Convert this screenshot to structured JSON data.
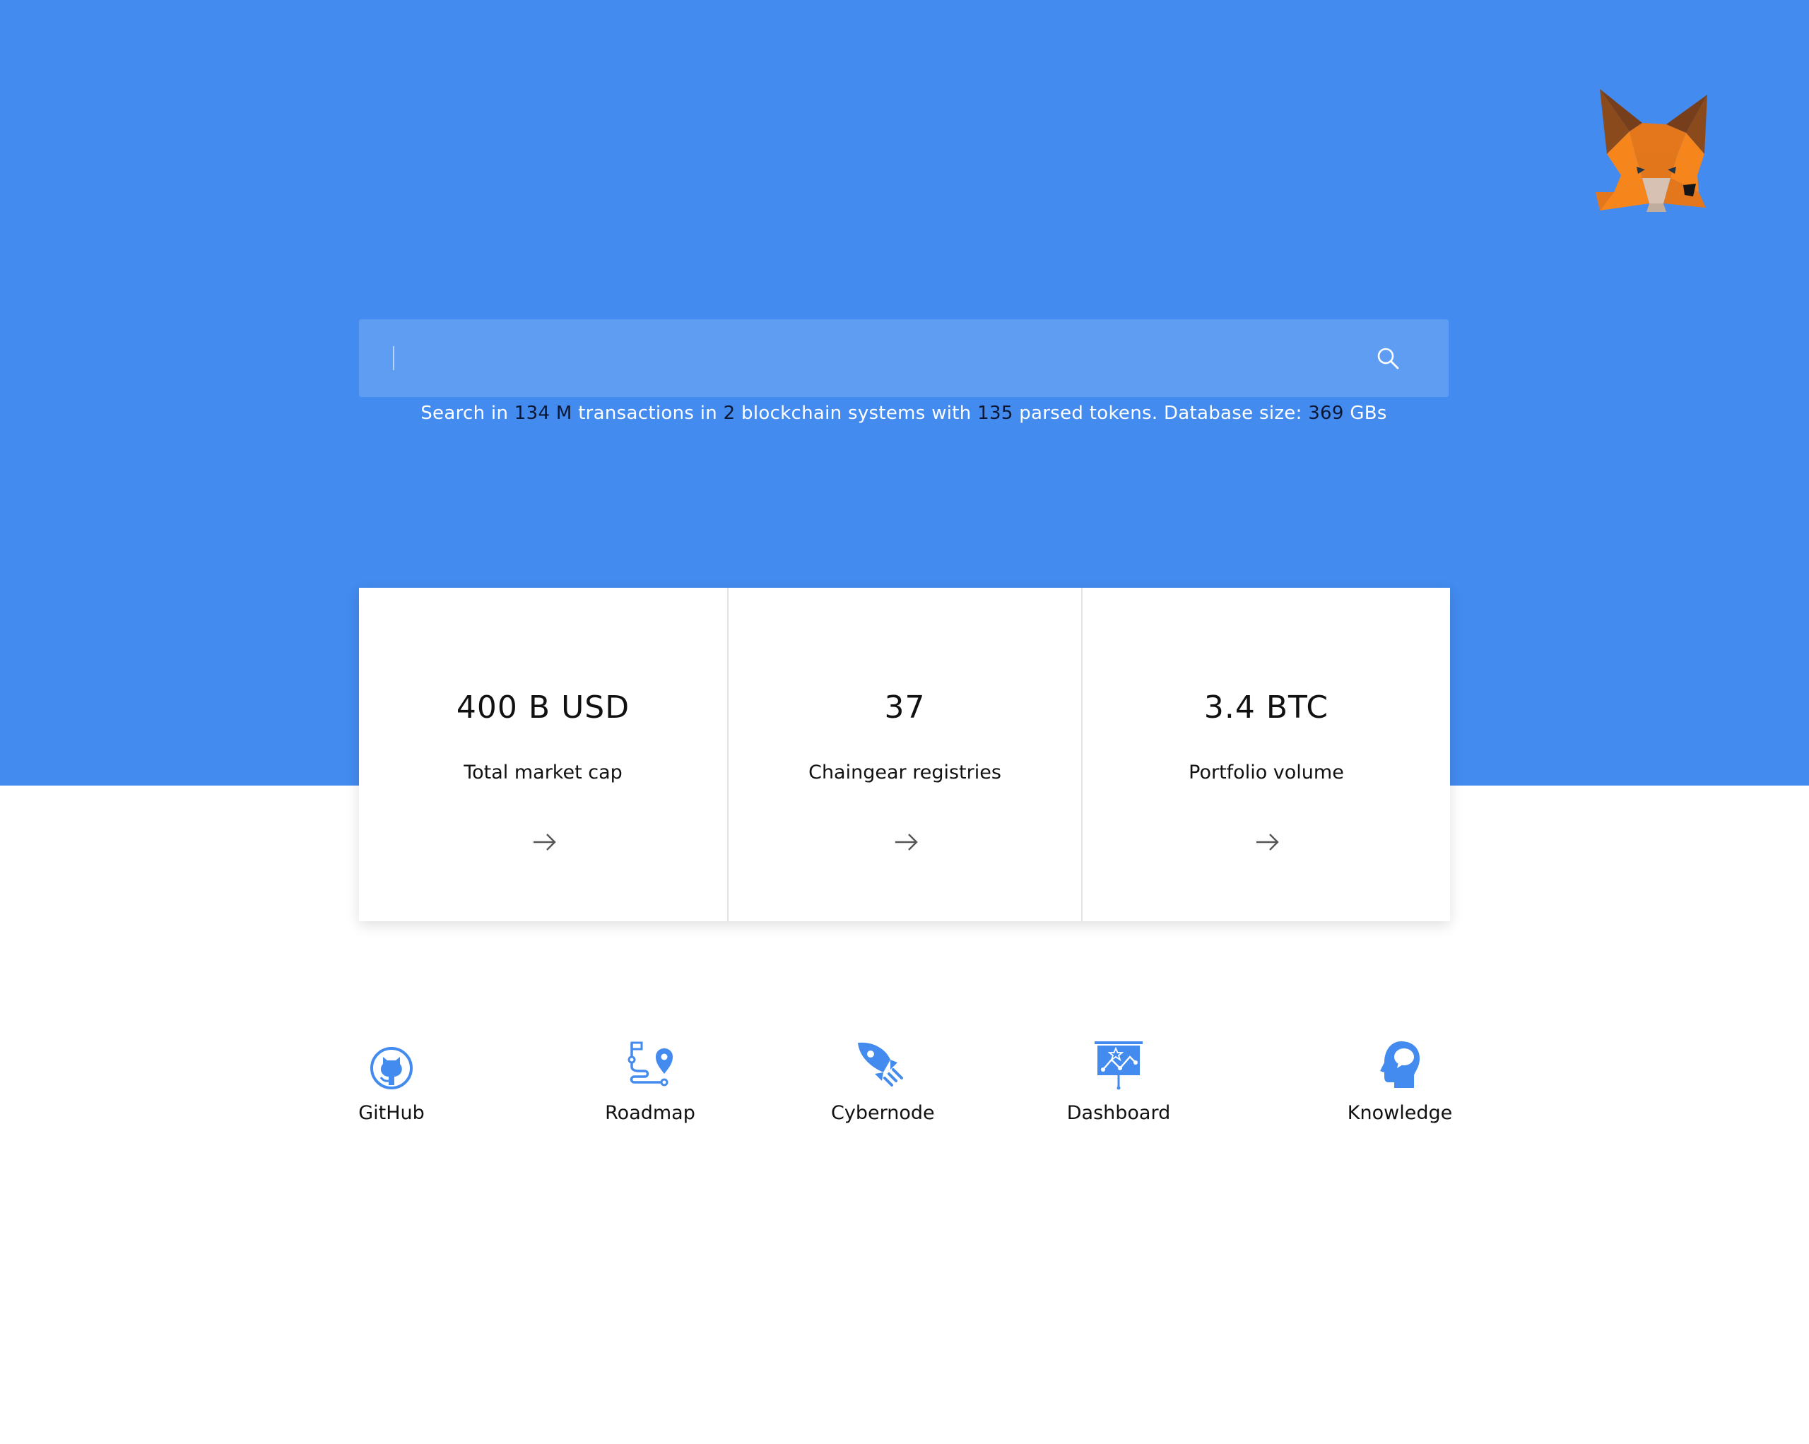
{
  "search": {
    "placeholder": "",
    "value": ""
  },
  "stats": {
    "prefix": "Search in ",
    "transactions": "134 M",
    "part2": " transactions in ",
    "systems": "2",
    "part3": " blockchain systems with ",
    "tokens": "135",
    "part4": " parsed tokens. Database size: ",
    "db_size": "369",
    "suffix": " GBs"
  },
  "cards": [
    {
      "value": "400 B USD",
      "label": "Total market cap"
    },
    {
      "value": "37",
      "label": "Chaingear registries"
    },
    {
      "value": "3.4 BTC",
      "label": "Portfolio volume"
    }
  ],
  "links": [
    {
      "label": "GitHub",
      "icon": "github-icon"
    },
    {
      "label": "Roadmap",
      "icon": "roadmap-icon"
    },
    {
      "label": "Cybernode",
      "icon": "rocket-icon"
    },
    {
      "label": "Dashboard",
      "icon": "dashboard-icon"
    },
    {
      "label": "Knowledge",
      "icon": "head-icon"
    }
  ],
  "colors": {
    "hero": "#438bef",
    "search_bg": "#5e9df1",
    "accent": "#438bef",
    "fox_orange": "#f6851b",
    "fox_dark": "#763e1a"
  }
}
